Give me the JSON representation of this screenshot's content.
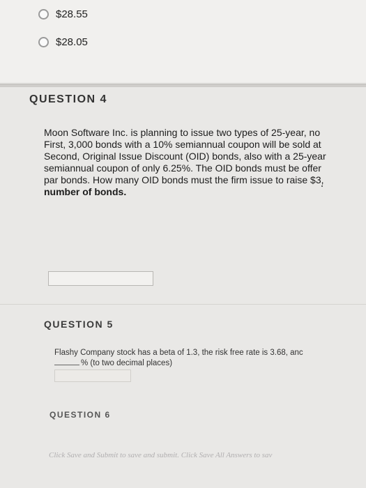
{
  "options": [
    {
      "label": "$28.55",
      "selected": false
    },
    {
      "label": "$28.05",
      "selected": false
    }
  ],
  "question4": {
    "header": "QUESTION 4",
    "lines": [
      "Moon Software Inc. is planning to issue two types of 25-year, no",
      "First, 3,000 bonds with a 10% semiannual coupon will be sold at",
      "Second, Original Issue Discount (OID) bonds, also with a 25-year",
      "semiannual coupon of only 6.25%. The OID bonds must be offer",
      "par bonds. How many OID bonds must the firm issue to raise $3,"
    ],
    "last_line": "number of bonds.",
    "answer_value": ""
  },
  "question5": {
    "header": "QUESTION 5",
    "line1": "Flashy Company stock has a beta of 1.3, the risk free rate is 3.68, anc",
    "line2": "% (to two decimal places)",
    "answer_value": ""
  },
  "question6": {
    "header": "QUESTION 6"
  },
  "footer": {
    "text": "Click Save and Submit to save and submit. Click Save All Answers to sav"
  }
}
